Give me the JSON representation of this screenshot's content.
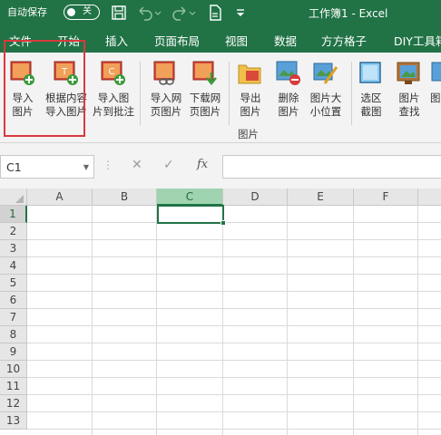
{
  "titlebar": {
    "autosave_label": "自动保存",
    "autosave_state": "关",
    "title": "工作簿1 - Excel",
    "icons": [
      "save-icon",
      "undo-icon",
      "redo-icon",
      "document-icon",
      "customize-qat-icon"
    ]
  },
  "menu": {
    "tabs": [
      "文件",
      "开始",
      "插入",
      "页面布局",
      "视图",
      "数据",
      "方方格子",
      "DIY工具箱"
    ]
  },
  "ribbon": {
    "buttons": [
      {
        "line1": "导入",
        "line2": "图片",
        "icon": "import-image-icon"
      },
      {
        "line1": "根据内容",
        "line2": "导入图片",
        "icon": "import-by-content-icon"
      },
      {
        "line1": "导入图",
        "line2": "片到批注",
        "icon": "image-to-comment-icon"
      },
      {
        "line1": "导入网",
        "line2": "页图片",
        "icon": "import-web-image-icon"
      },
      {
        "line1": "下载网",
        "line2": "页图片",
        "icon": "download-web-image-icon"
      },
      {
        "line1": "导出",
        "line2": "图片",
        "icon": "export-image-icon"
      },
      {
        "line1": "删除",
        "line2": "图片",
        "icon": "delete-image-icon"
      },
      {
        "line1": "图片大",
        "line2": "小位置",
        "icon": "image-size-position-icon"
      },
      {
        "line1": "选区",
        "line2": "截图",
        "icon": "selection-screenshot-icon"
      },
      {
        "line1": "图片",
        "line2": "查找",
        "icon": "image-find-icon"
      },
      {
        "line1": "图",
        "line2": "",
        "icon": "image-more-icon"
      }
    ],
    "group_label": "图片"
  },
  "formula_bar": {
    "name_box": "C1",
    "cancel": "✕",
    "confirm": "✓",
    "fx": "fx",
    "value": ""
  },
  "grid": {
    "columns": [
      "A",
      "B",
      "C",
      "D",
      "E",
      "F"
    ],
    "rows": [
      "1",
      "2",
      "3",
      "4",
      "5",
      "6",
      "7",
      "8",
      "9",
      "10",
      "11",
      "12",
      "13"
    ],
    "active_cell": "C1"
  },
  "colors": {
    "accent": "#217346",
    "highlight_box": "#d9393e",
    "selected_header": "#a0d3b0"
  }
}
